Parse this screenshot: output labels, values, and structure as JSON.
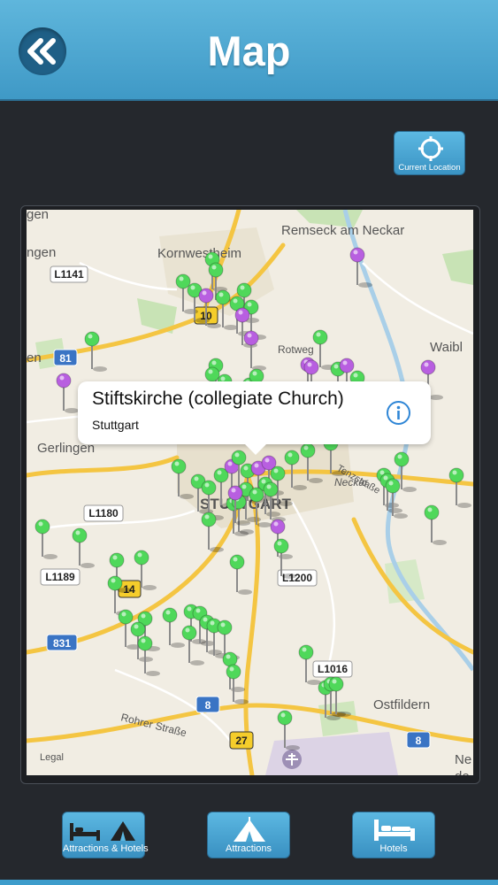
{
  "header": {
    "title": "Map"
  },
  "current_location": {
    "label": "Current Location"
  },
  "map": {
    "labels": {
      "kornwestheim": "Kornwestheim",
      "remseck": "Remseck am Neckar",
      "rotweg": "Rotweg",
      "waibl": "Waibl",
      "gerlingen": "Gerlingen",
      "stuttgart": "STUTTGART",
      "neckar": "Neckar",
      "ostfildern": "Ostfildern",
      "rohrer": "Rohrer Straße",
      "ne": "Ne",
      "de": "de",
      "gen_top": "gen",
      "ngen": "ngen",
      "en": "en",
      "enzstrasse": "Tenzstraße"
    },
    "road_shields": {
      "l1141": "L1141",
      "b10": "10",
      "b81": "81",
      "l1180": "L1180",
      "l1189": "L1189",
      "b14": "14",
      "l1200": "L1200",
      "a831": "831",
      "l1016": "L1016",
      "a8a": "8",
      "b27": "27",
      "a8b": "8"
    },
    "legal": "Legal"
  },
  "callout": {
    "title": "Stiftskirche (collegiate Church)",
    "subtitle": "Stuttgart"
  },
  "tabs": [
    {
      "label": "Attractions & Hotels"
    },
    {
      "label": "Attractions"
    },
    {
      "label": "Hotels"
    }
  ],
  "colors": {
    "header": "#4aa7d3",
    "background": "#25282d",
    "pin_green": "#4fd85a",
    "pin_purple": "#b85fe0"
  }
}
